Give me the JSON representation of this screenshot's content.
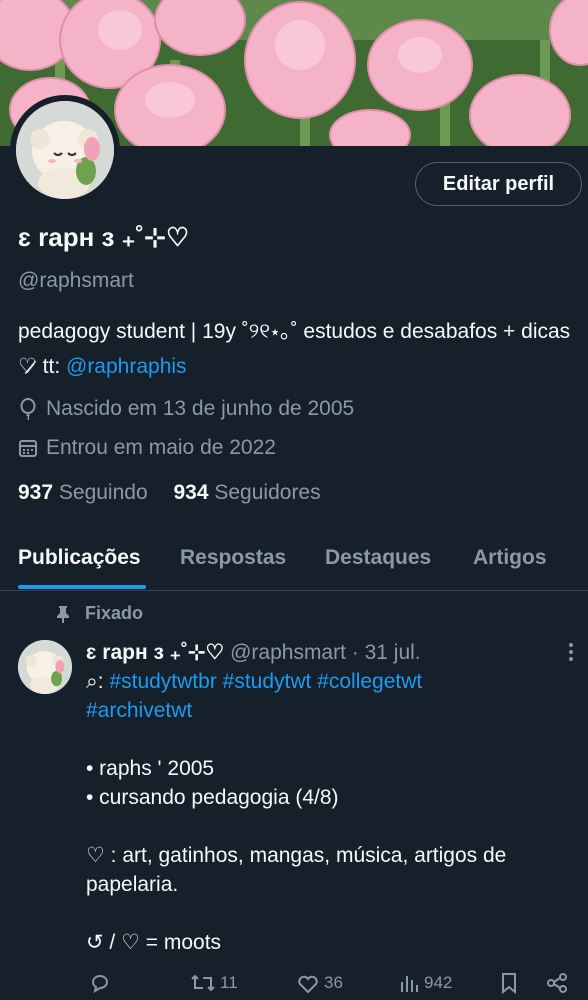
{
  "profile": {
    "name": "ɛ rapн ɜ ₊˚⊹♡",
    "handle": "@raphsmart",
    "edit_button": "Editar perfil",
    "bio_text": "pedagogy student | 19y ˚୨୧⋆｡˚ estudos e desabafos + dicas ♡̷ tt: ",
    "bio_link": "@raphraphis",
    "born": "Nascido em 13 de junho de 2005",
    "joined": "Entrou em maio de 2022",
    "following_count": "937",
    "following_label": "Seguindo",
    "followers_count": "934",
    "followers_label": "Seguidores"
  },
  "tabs": [
    "Publicações",
    "Respostas",
    "Destaques",
    "Artigos"
  ],
  "pinned_label": "Fixado",
  "post": {
    "name": "ɛ rapн ɜ ₊˚⊹♡",
    "meta": "@raphsmart · 31 jul.",
    "tags_prefix": "⌕: ",
    "tags_line1": "#studytwtbr #studytwt #collegetwt",
    "tags_line2": "#archivetwt",
    "bullet1": "• raphs ' 2005",
    "bullet2": "• cursando pedagogia (4/8)",
    "hearts_line1": "♡ :  art, gatinhos, mangas, música, artigos de",
    "hearts_line2": "papelaria.",
    "moots": "↺ / ♡ = moots"
  },
  "actions": {
    "retweets": "11",
    "likes": "36",
    "views": "942"
  },
  "colors": {
    "background": "#15202b",
    "accent": "#1d9bf0",
    "muted": "#8b98a5",
    "banner_tulip": "#f3a9bf"
  }
}
